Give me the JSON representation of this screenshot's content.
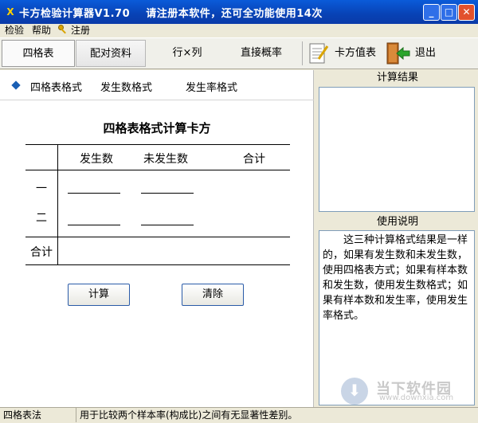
{
  "window": {
    "title": "卡方检验计算器V1.70    请注册本软件，还可全功能使用14次",
    "min": "_",
    "max": "□",
    "close": "✕",
    "icon_glyph": "X"
  },
  "menu": {
    "check": "检验",
    "help": "帮助",
    "register": "注册"
  },
  "toolbar": {
    "four_table": "四格表",
    "paired": "配对资料",
    "rxc": "行×列",
    "direct_prob": "直接概率",
    "chi_table": "卡方值表",
    "exit": "退出"
  },
  "formats": {
    "four_table_format": "四格表格式",
    "occurrence_format": "发生数格式",
    "rate_format": "发生率格式"
  },
  "calc": {
    "title": "四格表格式计算卡方",
    "col_occur": "发生数",
    "col_non_occur": "未发生数",
    "col_total": "合计",
    "row_one": "一",
    "row_two": "二",
    "row_total": "合计",
    "compute_button": "计算",
    "clear_button": "清除"
  },
  "result": {
    "header": "计算结果"
  },
  "usage": {
    "header": "使用说明",
    "text": "　　这三种计算格式结果是一样的，如果有发生数和未发生数，使用四格表方式；如果有样本数和发生数，使用发生数格式；如果有样本数和发生率，使用发生率格式。"
  },
  "watermark": {
    "name": "当下软件园",
    "url": "www.downxia.com"
  },
  "status": {
    "mode": "四格表法",
    "message": "用于比较两个样本率(构成比)之间有无显著性差别。"
  },
  "colors": {
    "titlebar": "#0a4fc8",
    "accent": "#1a5fb4",
    "close": "#e2512d"
  }
}
